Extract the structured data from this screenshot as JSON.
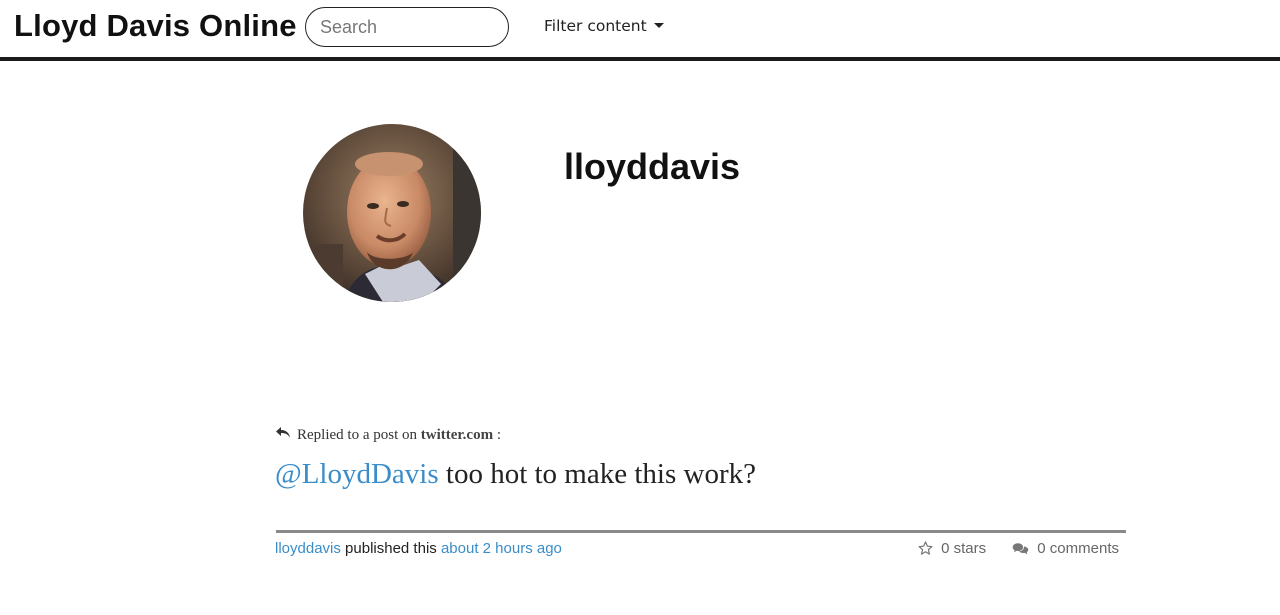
{
  "header": {
    "site_title": "Lloyd Davis Online",
    "search_placeholder": "Search",
    "filter_label": "Filter content"
  },
  "profile": {
    "name": "lloyddavis",
    "avatar_icon": "user-photo"
  },
  "post": {
    "context_prefix": "Replied to a post on",
    "context_site": "twitter.com",
    "context_suffix": ":",
    "mention": "@LloydDavis",
    "text": "too hot to make this work?"
  },
  "footer": {
    "author": "lloyddavis",
    "published_text": "published this",
    "time_ago": "about 2 hours ago",
    "stars_label": "0 stars",
    "comments_label": "0 comments"
  },
  "colors": {
    "link": "#3a8dc9",
    "header_border": "#1a1a1a"
  }
}
